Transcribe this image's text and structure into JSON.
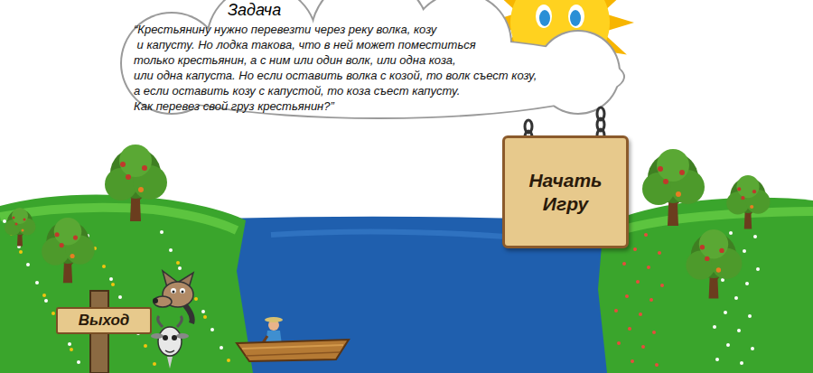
{
  "task": {
    "title": "Задача",
    "lines": [
      "“Крестьянину нужно перевезти через реку волка, козу",
      " и капусту. Но лодка такова, что в ней может поместиться",
      "только крестьянин, а с ним или один волк, или одна коза,",
      "или одна капуста. Но если оставить волка с козой, то волк съест козу,",
      "а если оставить козу с капустой, то коза съест капусту.",
      "Как перевез свой груз крестьянин?”"
    ]
  },
  "start_button": {
    "lines": [
      "Начать",
      "Игру"
    ]
  },
  "exit_button": {
    "label": "Выход"
  }
}
